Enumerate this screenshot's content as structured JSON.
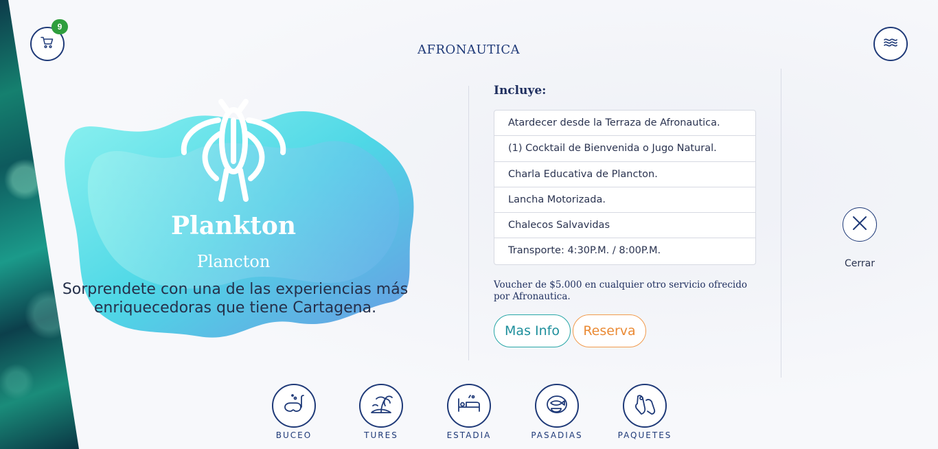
{
  "header": {
    "cart": {
      "icon": "cart-icon",
      "count": "9"
    },
    "logo_text": "AFRONAUTICA",
    "menu": {
      "icon": "menu-waves-icon"
    }
  },
  "experience": {
    "title": "Plankton",
    "subtitle": "Plancton",
    "description": "Sorprendete con una de las experiencias más enriquecedoras que tiene Cartagena."
  },
  "details": {
    "heading": "Incluye:",
    "includes": [
      "Atardecer desde la Terraza de Afronautica.",
      "(1) Cocktail de Bienvenida o Jugo Natural.",
      "Charla Educativa de Plancton.",
      "Lancha Motorizada.",
      "Chalecos Salvavidas",
      "Transporte: 4:30P.M. / 8:00P.M."
    ],
    "voucher": "Voucher de $5.000 en cualquier otro servicio ofrecido por Afronautica.",
    "more_info_label": "Mas Info",
    "reserve_label": "Reserva"
  },
  "close": {
    "label": "Cerrar"
  },
  "nav": [
    {
      "label": "BUCEO",
      "icon": "diving-mask-icon"
    },
    {
      "label": "TURES",
      "icon": "palm-island-icon"
    },
    {
      "label": "ESTADIA",
      "icon": "bed-icon"
    },
    {
      "label": "PASADIAS",
      "icon": "fish-icon"
    },
    {
      "label": "PAQUETES",
      "icon": "fins-icon"
    }
  ],
  "colors": {
    "primary": "#1f3a78",
    "badge": "#2e9e3d",
    "info_accent": "#26a6a6",
    "reserve_accent": "#f19a4c",
    "blob": "#46d8e6"
  }
}
